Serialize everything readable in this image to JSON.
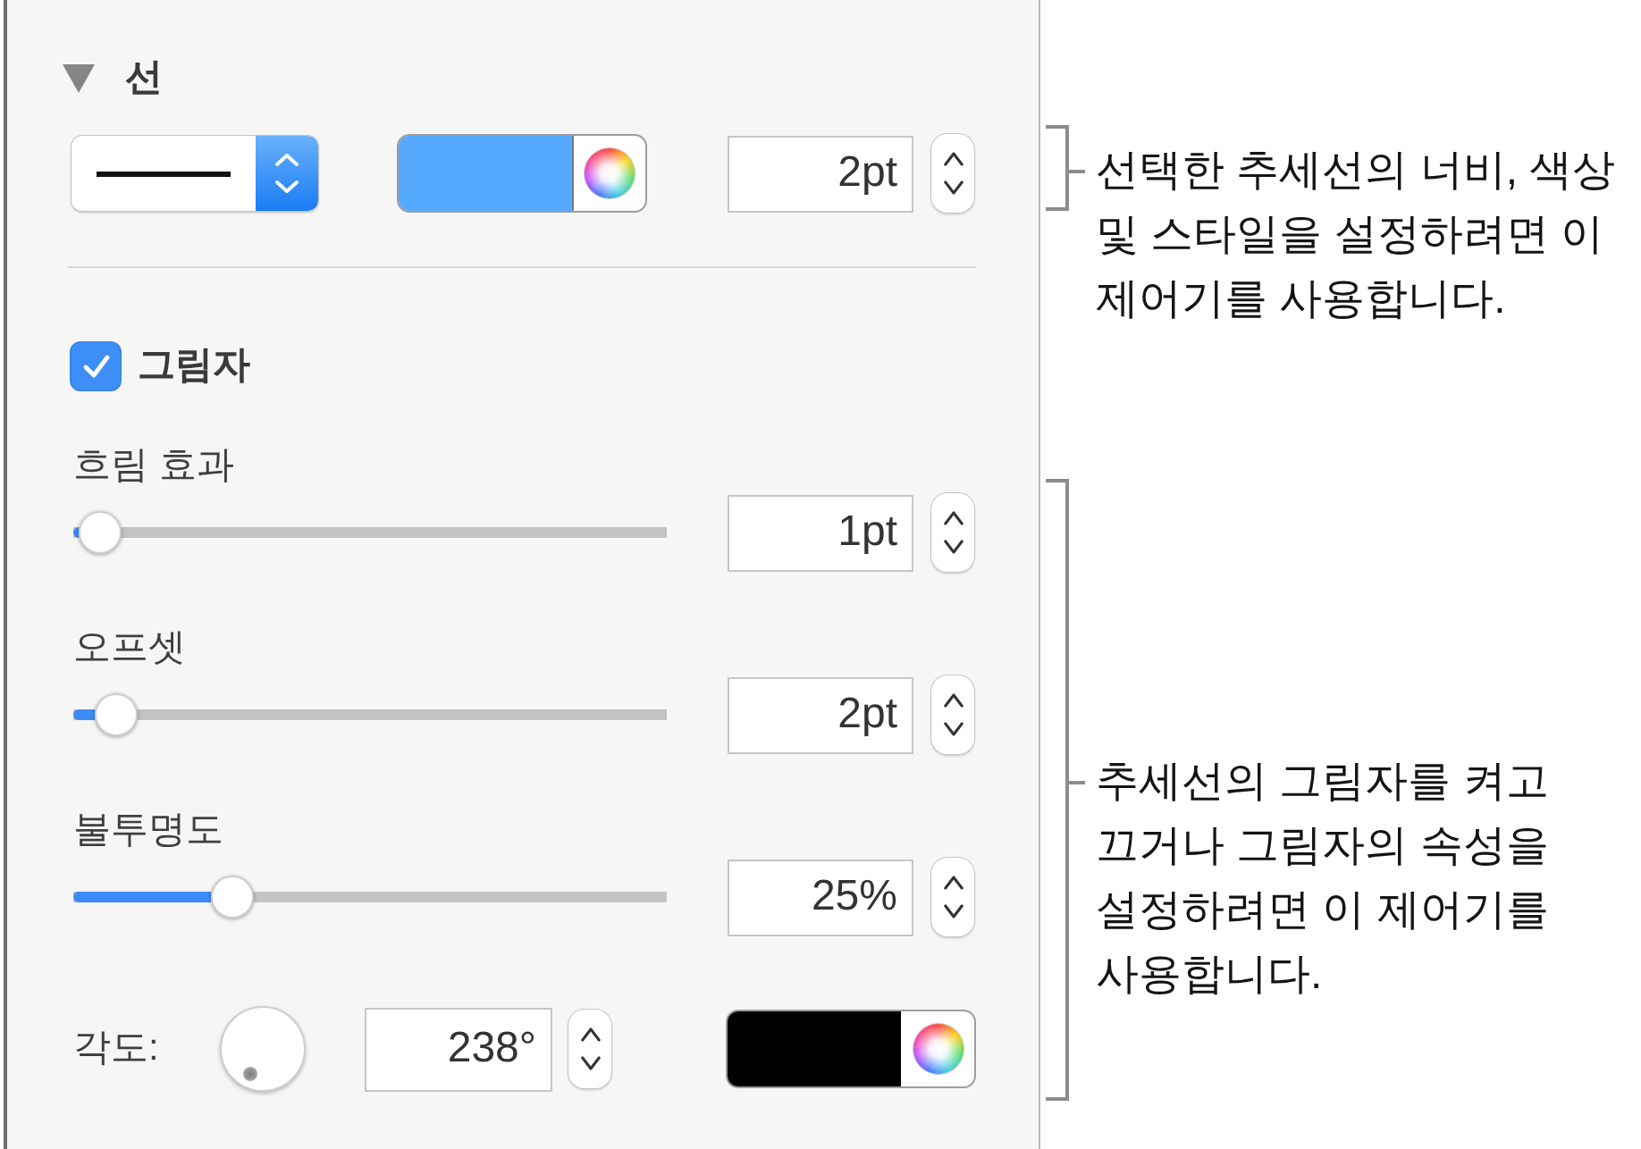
{
  "line_section": {
    "title": "선",
    "expanded": true,
    "line_style_popup": {
      "kind": "solid"
    },
    "color_well": {
      "color": "#55aaff"
    },
    "width_field": {
      "value": "2pt"
    }
  },
  "shadow_section": {
    "title": "그림자",
    "checked": true,
    "sliders": [
      {
        "label": "흐림 효과",
        "level": 0.01,
        "value": "1pt"
      },
      {
        "label": "오프셋",
        "level": 0.04,
        "value": "2pt"
      },
      {
        "label": "불투명도",
        "level": 0.25,
        "value": "25%"
      }
    ],
    "angle": {
      "label": "각도:",
      "value": "238°"
    },
    "color_well": {
      "color": "#000000"
    }
  },
  "callouts": [
    {
      "text": "선택한 추세선의 너비, 색상 및 스타일을 설정하려면 이 제어기를 사용합니다."
    },
    {
      "text": "추세선의 그림자를 켜고 끄거나 그림자의 속성을 설정하려면 이 제어기를 사용합니다."
    }
  ]
}
